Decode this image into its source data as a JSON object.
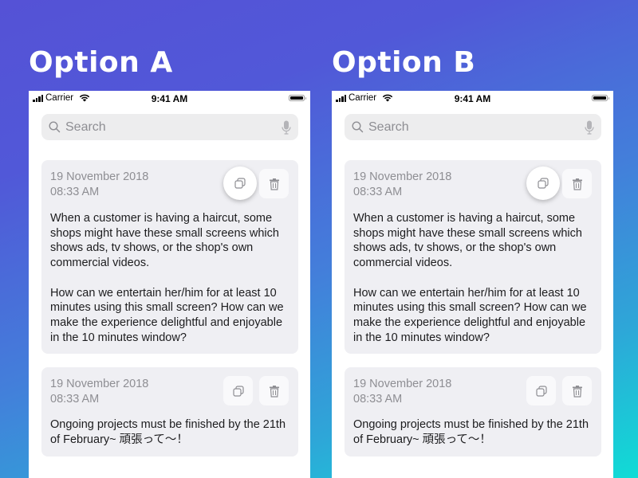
{
  "options": [
    {
      "title": "Option A",
      "status_bar": {
        "carrier": "Carrier",
        "time": "9:41 AM"
      },
      "search": {
        "placeholder": "Search",
        "value": ""
      },
      "notes": [
        {
          "date": "19 November 2018\n08:33 AM",
          "body": "When a customer is having a haircut, some shops might have these small screens which shows ads, tv shows, or the shop's own commercial videos.\n\nHow can we entertain her/him for at least 10 minutes using this small screen? How can we make the experience delightful and enjoyable in the 10 minutes window?",
          "actions": {
            "copy": "copy-icon",
            "delete": "trash-icon",
            "copy_state": "pressed"
          }
        },
        {
          "date": "19 November 2018\n08:33 AM",
          "body": "Ongoing projects must be finished by the 21th of February~ 頑張って〜！",
          "actions": {
            "copy": "copy-icon",
            "delete": "trash-icon",
            "copy_state": "normal"
          }
        }
      ]
    },
    {
      "title": "Option B",
      "status_bar": {
        "carrier": "Carrier",
        "time": "9:41 AM"
      },
      "search": {
        "placeholder": "Search",
        "value": ""
      },
      "notes": [
        {
          "date": "19 November 2018\n08:33 AM",
          "body": "When a customer is having a haircut, some shops might have these small screens which shows ads, tv shows, or the shop's own commercial videos.\n\nHow can we entertain her/him for at least 10 minutes using this small screen? How can we make the experience delightful and enjoyable in the 10 minutes window?",
          "actions": {
            "copy": "copy-icon",
            "delete": "trash-icon",
            "copy_state": "pressed"
          }
        },
        {
          "date": "19 November 2018\n08:33 AM",
          "body": "Ongoing projects must be finished by the 21th of February~ 頑張って〜！",
          "actions": {
            "copy": "copy-icon",
            "delete": "trash-icon",
            "copy_state": "normal"
          }
        }
      ]
    }
  ],
  "colors": {
    "gradient_start": "#5552d6",
    "gradient_end": "#10dcd6",
    "card_bg": "#efeff3",
    "meta_text": "#8e8e93",
    "search_bg": "#ededee"
  }
}
